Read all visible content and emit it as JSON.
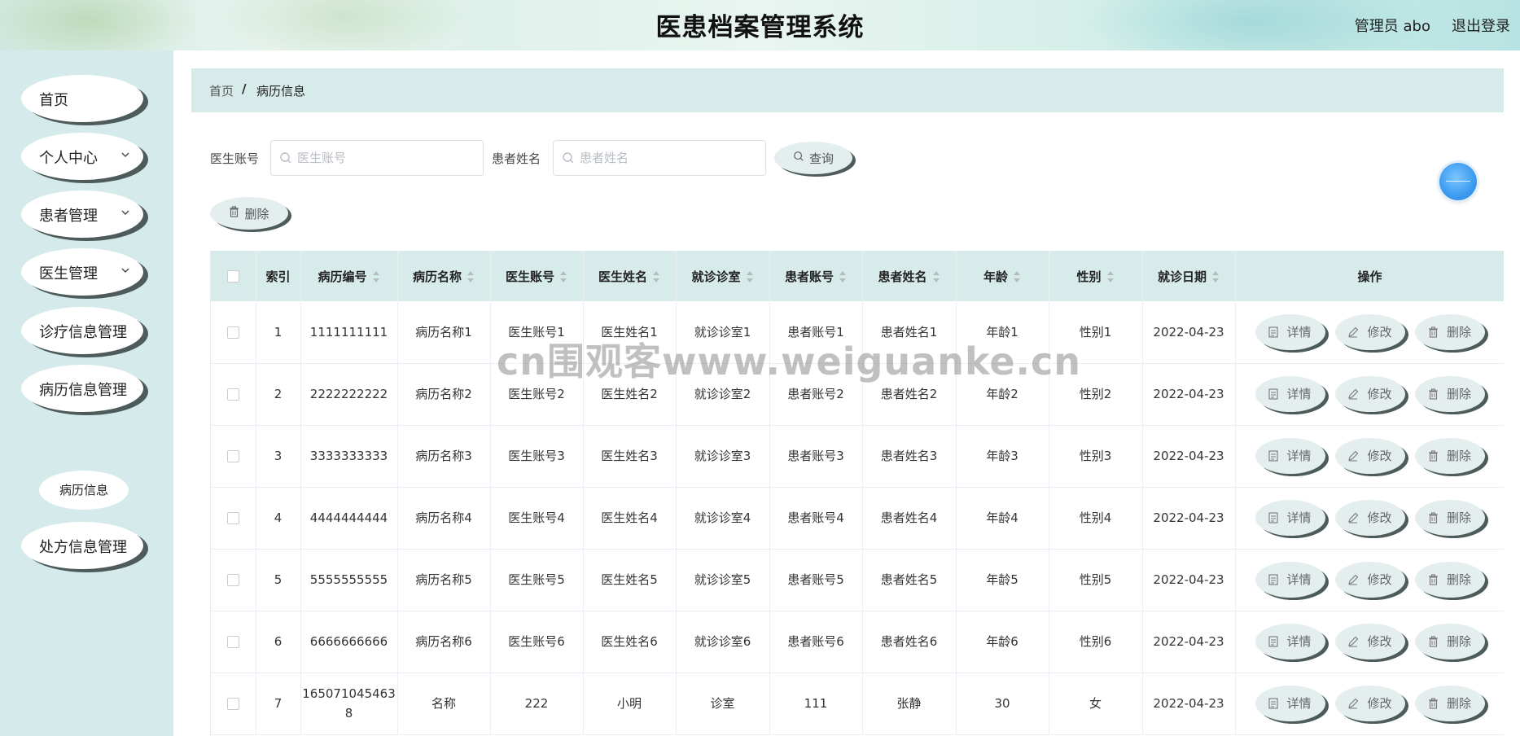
{
  "header": {
    "title": "医患档案管理系统",
    "user": "管理员 abo",
    "logout": "退出登录"
  },
  "sidebar": {
    "items": [
      {
        "label": "首页",
        "has_chevron": false
      },
      {
        "label": "个人中心",
        "has_chevron": true
      },
      {
        "label": "患者管理",
        "has_chevron": true
      },
      {
        "label": "医生管理",
        "has_chevron": true
      },
      {
        "label": "诊疗信息管理",
        "has_chevron": false
      },
      {
        "label": "病历信息管理",
        "has_chevron": false
      },
      {
        "label": "处方信息管理",
        "has_chevron": false
      }
    ],
    "active_subitem": "病历信息"
  },
  "breadcrumb": {
    "home": "首页",
    "separator": "/",
    "current": "病历信息"
  },
  "search": {
    "doctor_account_label": "医生账号",
    "doctor_account_placeholder": "医生账号",
    "doctor_account_value": "",
    "patient_name_label": "患者姓名",
    "patient_name_placeholder": "患者姓名",
    "patient_name_value": "",
    "query_label": "查询"
  },
  "toolbar": {
    "delete_label": "删除"
  },
  "table": {
    "columns": [
      {
        "label": "",
        "sortable": false
      },
      {
        "label": "索引",
        "sortable": false
      },
      {
        "label": "病历编号",
        "sortable": true
      },
      {
        "label": "病历名称",
        "sortable": true
      },
      {
        "label": "医生账号",
        "sortable": true
      },
      {
        "label": "医生姓名",
        "sortable": true
      },
      {
        "label": "就诊诊室",
        "sortable": true
      },
      {
        "label": "患者账号",
        "sortable": true
      },
      {
        "label": "患者姓名",
        "sortable": true
      },
      {
        "label": "年龄",
        "sortable": true
      },
      {
        "label": "性别",
        "sortable": true
      },
      {
        "label": "就诊日期",
        "sortable": true
      },
      {
        "label": "操作",
        "sortable": false
      }
    ],
    "rows": [
      [
        "1",
        "1111111111",
        "病历名称1",
        "医生账号1",
        "医生姓名1",
        "就诊诊室1",
        "患者账号1",
        "患者姓名1",
        "年龄1",
        "性别1",
        "2022-04-23"
      ],
      [
        "2",
        "2222222222",
        "病历名称2",
        "医生账号2",
        "医生姓名2",
        "就诊诊室2",
        "患者账号2",
        "患者姓名2",
        "年龄2",
        "性别2",
        "2022-04-23"
      ],
      [
        "3",
        "3333333333",
        "病历名称3",
        "医生账号3",
        "医生姓名3",
        "就诊诊室3",
        "患者账号3",
        "患者姓名3",
        "年龄3",
        "性别3",
        "2022-04-23"
      ],
      [
        "4",
        "4444444444",
        "病历名称4",
        "医生账号4",
        "医生姓名4",
        "就诊诊室4",
        "患者账号4",
        "患者姓名4",
        "年龄4",
        "性别4",
        "2022-04-23"
      ],
      [
        "5",
        "5555555555",
        "病历名称5",
        "医生账号5",
        "医生姓名5",
        "就诊诊室5",
        "患者账号5",
        "患者姓名5",
        "年龄5",
        "性别5",
        "2022-04-23"
      ],
      [
        "6",
        "6666666666",
        "病历名称6",
        "医生账号6",
        "医生姓名6",
        "就诊诊室6",
        "患者账号6",
        "患者姓名6",
        "年龄6",
        "性别6",
        "2022-04-23"
      ],
      [
        "7",
        "1650710454638",
        "名称",
        "222",
        "小明",
        "诊室",
        "111",
        "张静",
        "30",
        "女",
        "2022-04-23"
      ]
    ],
    "actions": {
      "detail": "详情",
      "edit": "修改",
      "delete": "删除"
    }
  },
  "watermark": "cn围观客www.weiguanke.cn",
  "colors": {
    "sidebar_bg": "#d5eaea",
    "table_header_bg": "#d8ebeb",
    "button_bg": "#e4eeee",
    "button_shadow": "#4e5b5b",
    "float_ball": "#3b9bf0"
  }
}
